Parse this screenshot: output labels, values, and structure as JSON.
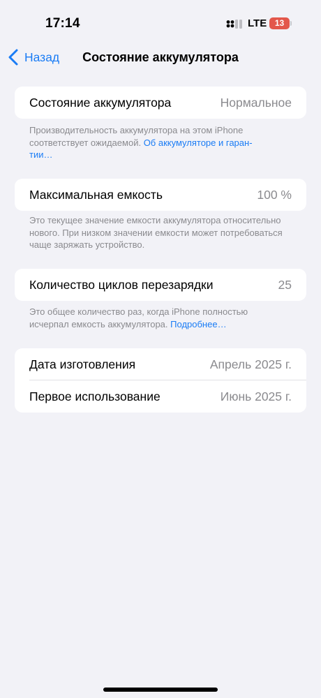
{
  "status_bar": {
    "time": "17:14",
    "network": "LTE",
    "battery_percent": "13"
  },
  "nav": {
    "back_label": "Назад",
    "title": "Состояние аккумулятора"
  },
  "battery_health": {
    "label": "Состояние аккумулятора",
    "value": "Нормальное",
    "footnote": "Производительность аккумулятора на этом iPhone соответствует ожидаемой.",
    "footnote_link": "Об аккумуляторе и гаран-\nтии…"
  },
  "max_capacity": {
    "label": "Максимальная емкость",
    "value": "100 %",
    "footnote": "Это текущее значение емкости аккумулятора относительно нового. При низком значении емкости может потребоваться чаще заряжать устройство."
  },
  "cycle_count": {
    "label": "Количество циклов перезарядки",
    "value": "25",
    "footnote": "Это общее количество раз, когда iPhone полностью исчерпал емкость аккумулятора.",
    "footnote_link": "Подробнее…"
  },
  "dates": {
    "manufacture_label": "Дата изготовления",
    "manufacture_value": "Апрель 2025 г.",
    "first_use_label": "Первое использование",
    "first_use_value": "Июнь 2025 г."
  },
  "colors": {
    "accent": "#1a7cf5",
    "background": "#f2f2f7",
    "battery_low": "#e3574b"
  }
}
